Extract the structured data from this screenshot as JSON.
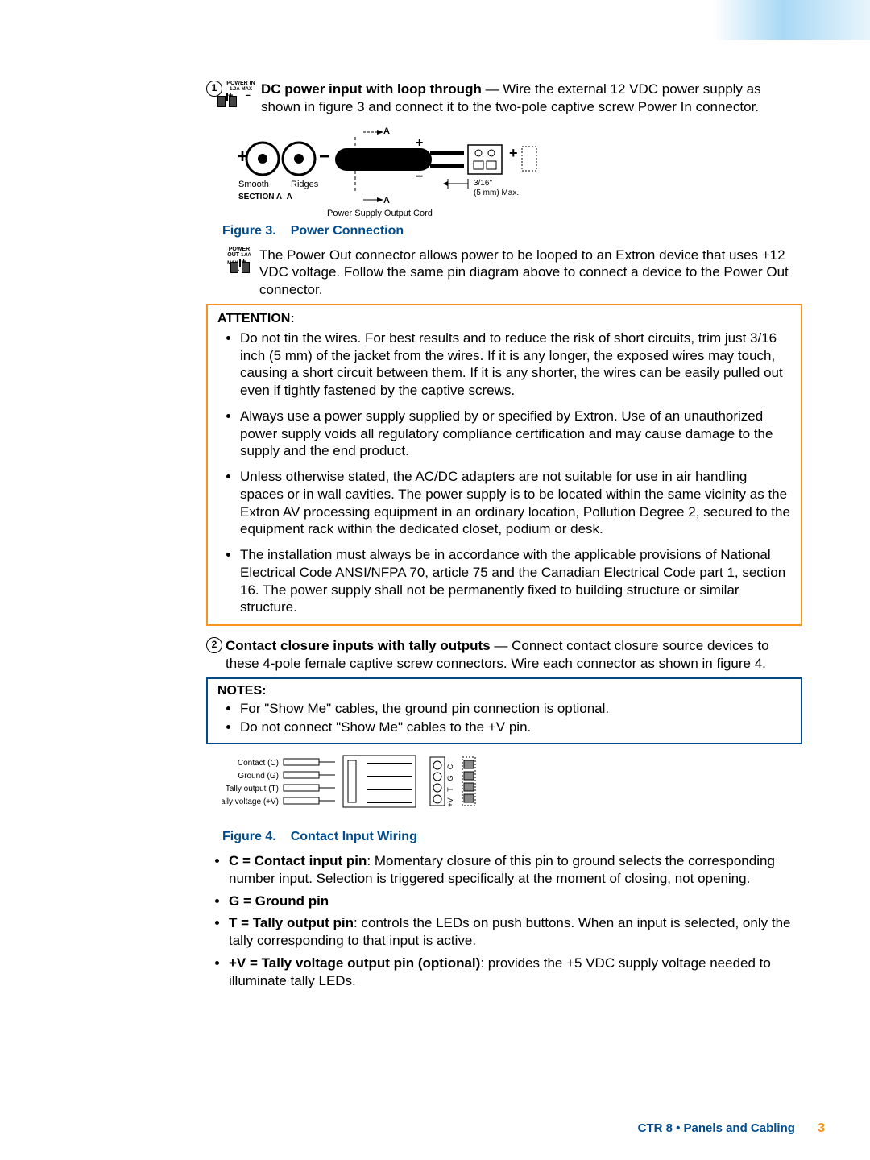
{
  "item1": {
    "number": "1",
    "conn_label": "POWER IN",
    "conn_sub1": "1.0A",
    "conn_sub2": "MAX",
    "lead": "DC power input with loop through",
    "text": " — Wire the external 12 VDC power supply as shown in figure 3 and connect it to the two-pole captive screw Power In connector."
  },
  "fig3": {
    "smooth": "Smooth",
    "ridges": "Ridges",
    "section": "SECTION  A–A",
    "a_top": "A",
    "a_bot": "A",
    "dim": "3/16\"",
    "dim2": "(5 mm) Max.",
    "cord": "Power Supply Output Cord",
    "caption_num": "Figure 3.",
    "caption_txt": "Power Connection"
  },
  "powerout": {
    "conn_label": "POWER OUT",
    "conn_sub1": "1.0A",
    "conn_sub2": "MAX",
    "text": "The Power Out connector allows power to be looped to an Extron device that uses +12 VDC voltage. Follow the same pin diagram above to connect a device to the Power Out connector."
  },
  "attention": {
    "heading": "ATTENTION:",
    "items": [
      "Do not tin the wires. For best results and to reduce the risk of short circuits, trim just 3/16 inch (5 mm) of the jacket from the wires. If it is any longer, the exposed wires may touch, causing a short circuit between them. If it is any shorter, the wires can be easily pulled out even if tightly fastened by the captive screws.",
      "Always use a power supply supplied by or specified by Extron. Use of an unauthorized power supply voids all regulatory compliance certification and may cause damage to the supply and the end product.",
      "Unless otherwise stated, the AC/DC adapters are not suitable for use in air handling spaces or in wall cavities. The power supply is to be located within the same vicinity as the Extron AV processing equipment in an ordinary location, Pollution Degree 2, secured to the equipment rack within the dedicated closet, podium or desk.",
      "The installation must always be in accordance with the applicable provisions of National Electrical Code ANSI/NFPA 70, article 75 and the Canadian Electrical Code part 1, section 16. The power supply shall not be permanently fixed to building structure or similar structure."
    ]
  },
  "item2": {
    "number": "2",
    "lead": "Contact closure inputs with tally outputs",
    "text": " — Connect contact closure source devices to these 4-pole female captive screw connectors. Wire each connector as shown in figure 4."
  },
  "notes": {
    "heading": "NOTES:",
    "items": [
      "For \"Show Me\" cables, the ground pin connection is optional.",
      "Do not connect \"Show Me\" cables to the +V pin."
    ]
  },
  "fig4": {
    "l1": "Contact (C)",
    "l2": "Ground (G)",
    "l3": "Tally output (T)",
    "l4": "Tally voltage (+V)",
    "r1": "C",
    "r2": "G",
    "r3": "T",
    "r4": "+V",
    "caption_num": "Figure 4.",
    "caption_txt": "Contact Input Wiring"
  },
  "pins": {
    "c_lead": "C = Contact input pin",
    "c_text": ": Momentary closure of this pin to ground selects the corresponding number input. Selection is triggered specifically at the moment of closing, not opening.",
    "g_lead": "G = Ground pin",
    "t_lead": "T = Tally output pin",
    "t_text": ": controls the LEDs on push buttons. When an input is selected, only the tally corresponding to that input is active.",
    "v_lead": "+V = Tally voltage output pin (optional)",
    "v_text": ": provides the +5 VDC supply voltage needed to illuminate tally LEDs."
  },
  "footer": {
    "text": "CTR 8 • Panels and Cabling",
    "page": "3"
  }
}
